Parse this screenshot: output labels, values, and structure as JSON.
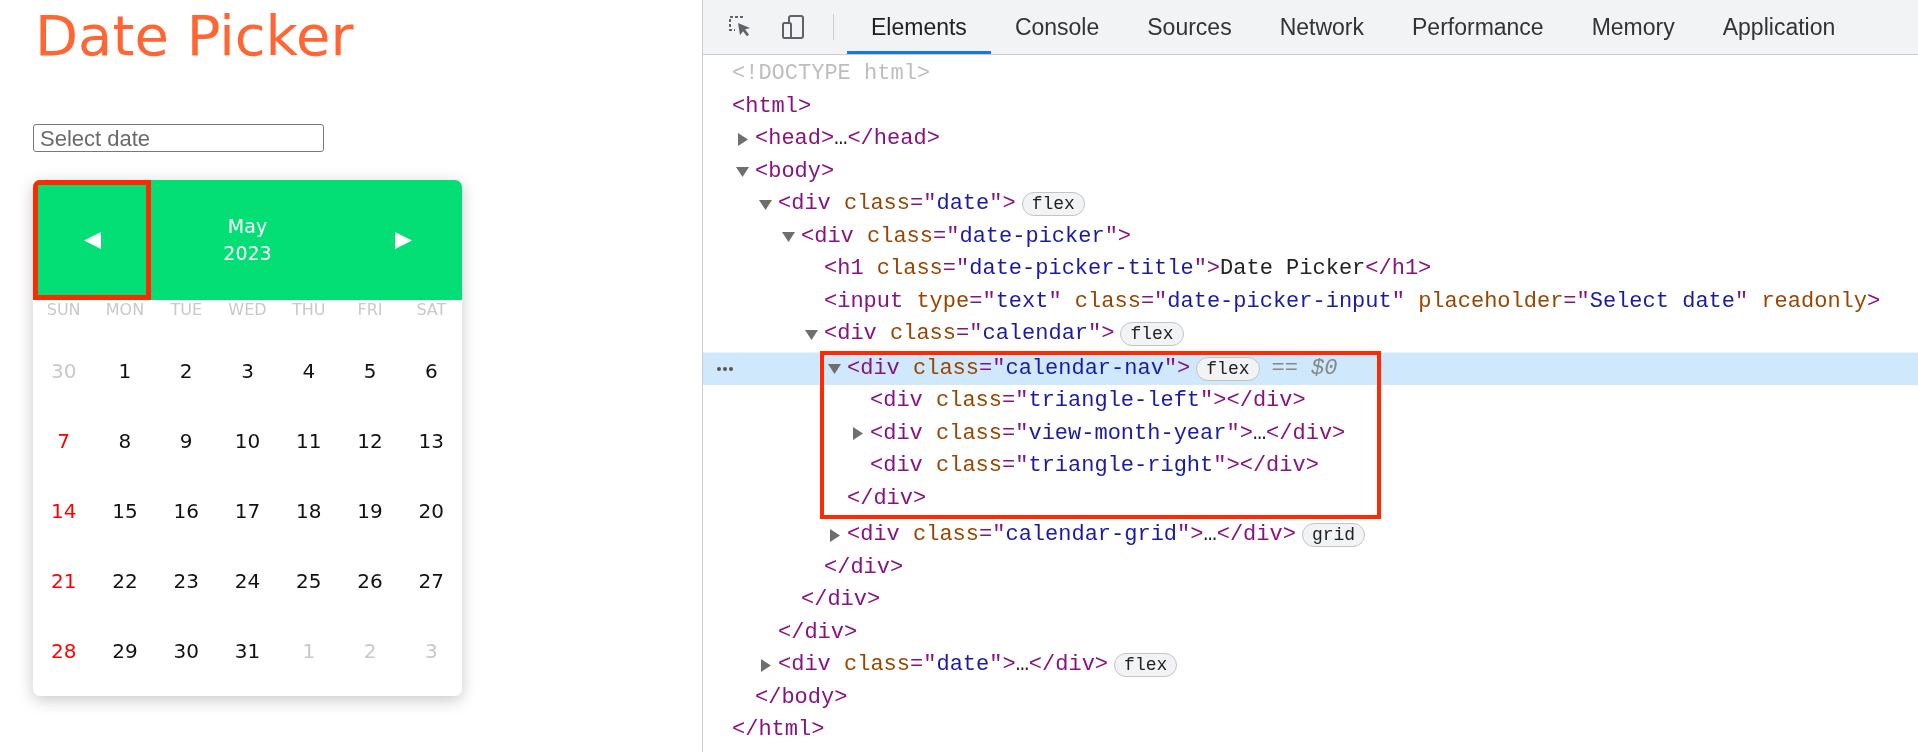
{
  "page": {
    "title": "Date Picker",
    "input": {
      "placeholder": "Select date"
    },
    "calendar": {
      "month": "May",
      "year": "2023",
      "prev_highlighted": true,
      "weekdays": [
        "SUN",
        "MON",
        "TUE",
        "WED",
        "THU",
        "FRI",
        "SAT"
      ],
      "weeks": [
        [
          {
            "day": "30",
            "kind": "other"
          },
          {
            "day": "1",
            "kind": "normal"
          },
          {
            "day": "2",
            "kind": "normal"
          },
          {
            "day": "3",
            "kind": "normal"
          },
          {
            "day": "4",
            "kind": "normal"
          },
          {
            "day": "5",
            "kind": "normal"
          },
          {
            "day": "6",
            "kind": "normal"
          }
        ],
        [
          {
            "day": "7",
            "kind": "sunday"
          },
          {
            "day": "8",
            "kind": "normal"
          },
          {
            "day": "9",
            "kind": "normal"
          },
          {
            "day": "10",
            "kind": "normal"
          },
          {
            "day": "11",
            "kind": "normal"
          },
          {
            "day": "12",
            "kind": "normal"
          },
          {
            "day": "13",
            "kind": "normal"
          }
        ],
        [
          {
            "day": "14",
            "kind": "sunday"
          },
          {
            "day": "15",
            "kind": "normal"
          },
          {
            "day": "16",
            "kind": "normal"
          },
          {
            "day": "17",
            "kind": "normal"
          },
          {
            "day": "18",
            "kind": "normal"
          },
          {
            "day": "19",
            "kind": "normal"
          },
          {
            "day": "20",
            "kind": "normal"
          }
        ],
        [
          {
            "day": "21",
            "kind": "sunday"
          },
          {
            "day": "22",
            "kind": "normal"
          },
          {
            "day": "23",
            "kind": "normal"
          },
          {
            "day": "24",
            "kind": "normal"
          },
          {
            "day": "25",
            "kind": "normal"
          },
          {
            "day": "26",
            "kind": "normal"
          },
          {
            "day": "27",
            "kind": "normal"
          }
        ],
        [
          {
            "day": "28",
            "kind": "sunday"
          },
          {
            "day": "29",
            "kind": "normal"
          },
          {
            "day": "30",
            "kind": "normal"
          },
          {
            "day": "31",
            "kind": "normal"
          },
          {
            "day": "1",
            "kind": "other"
          },
          {
            "day": "2",
            "kind": "other"
          },
          {
            "day": "3",
            "kind": "other"
          }
        ]
      ]
    }
  },
  "devtools": {
    "tabs": [
      {
        "label": "Elements",
        "selected": true
      },
      {
        "label": "Console",
        "selected": false
      },
      {
        "label": "Sources",
        "selected": false
      },
      {
        "label": "Network",
        "selected": false
      },
      {
        "label": "Performance",
        "selected": false
      },
      {
        "label": "Memory",
        "selected": false
      },
      {
        "label": "Application",
        "selected": false
      }
    ],
    "tree": [
      {
        "selected": false,
        "open": [
          {
            "kind": "doc",
            "text": "<!DOCTYPE html>"
          }
        ]
      },
      {
        "selected": false,
        "open": [
          {
            "kind": "tag",
            "text": "<html>"
          }
        ],
        "close": [
          {
            "kind": "tag",
            "text": "</html>"
          }
        ],
        "children": [
          {
            "selected": false,
            "expanded": false,
            "open": [
              {
                "kind": "tag",
                "text": "<head>"
              },
              {
                "kind": "text",
                "text": "…"
              },
              {
                "kind": "tag",
                "text": "</head>"
              }
            ]
          },
          {
            "selected": false,
            "expanded": true,
            "open": [
              {
                "kind": "tag",
                "text": "<body>"
              }
            ],
            "close": [
              {
                "kind": "tag",
                "text": "</body>"
              }
            ],
            "children": [
              {
                "selected": false,
                "expanded": true,
                "open": [
                  {
                    "kind": "tag",
                    "text": "<div "
                  },
                  {
                    "kind": "attr",
                    "text": "class"
                  },
                  {
                    "kind": "tag",
                    "text": "=\""
                  },
                  {
                    "kind": "val",
                    "text": "date"
                  },
                  {
                    "kind": "tag",
                    "text": "\">"
                  }
                ],
                "badge": "flex",
                "close": [
                  {
                    "kind": "tag",
                    "text": "</div>"
                  }
                ],
                "children": [
                  {
                    "selected": false,
                    "expanded": true,
                    "open": [
                      {
                        "kind": "tag",
                        "text": "<div "
                      },
                      {
                        "kind": "attr",
                        "text": "class"
                      },
                      {
                        "kind": "tag",
                        "text": "=\""
                      },
                      {
                        "kind": "val",
                        "text": "date-picker"
                      },
                      {
                        "kind": "tag",
                        "text": "\">"
                      }
                    ],
                    "close": [
                      {
                        "kind": "tag",
                        "text": "</div>"
                      }
                    ],
                    "children": [
                      {
                        "selected": false,
                        "open": [
                          {
                            "kind": "tag",
                            "text": "<h1 "
                          },
                          {
                            "kind": "attr",
                            "text": "class"
                          },
                          {
                            "kind": "tag",
                            "text": "=\""
                          },
                          {
                            "kind": "val",
                            "text": "date-picker-title"
                          },
                          {
                            "kind": "tag",
                            "text": "\">"
                          },
                          {
                            "kind": "text",
                            "text": "Date Picker"
                          },
                          {
                            "kind": "tag",
                            "text": "</h1>"
                          }
                        ]
                      },
                      {
                        "selected": false,
                        "open": [
                          {
                            "kind": "tag",
                            "text": "<input "
                          },
                          {
                            "kind": "attr",
                            "text": "type"
                          },
                          {
                            "kind": "tag",
                            "text": "=\""
                          },
                          {
                            "kind": "val",
                            "text": "text"
                          },
                          {
                            "kind": "tag",
                            "text": "\" "
                          },
                          {
                            "kind": "attr",
                            "text": "class"
                          },
                          {
                            "kind": "tag",
                            "text": "=\""
                          },
                          {
                            "kind": "val",
                            "text": "date-picker-input"
                          },
                          {
                            "kind": "tag",
                            "text": "\" "
                          },
                          {
                            "kind": "attr",
                            "text": "placeholder"
                          },
                          {
                            "kind": "tag",
                            "text": "=\""
                          },
                          {
                            "kind": "val",
                            "text": "Select date"
                          },
                          {
                            "kind": "tag",
                            "text": "\" "
                          },
                          {
                            "kind": "attr",
                            "text": "readonly"
                          },
                          {
                            "kind": "tag",
                            "text": ">"
                          }
                        ]
                      },
                      {
                        "selected": false,
                        "expanded": true,
                        "open": [
                          {
                            "kind": "tag",
                            "text": "<div "
                          },
                          {
                            "kind": "attr",
                            "text": "class"
                          },
                          {
                            "kind": "tag",
                            "text": "=\""
                          },
                          {
                            "kind": "val",
                            "text": "calendar"
                          },
                          {
                            "kind": "tag",
                            "text": "\">"
                          }
                        ],
                        "badge": "flex",
                        "close": [
                          {
                            "kind": "tag",
                            "text": "</div>"
                          }
                        ],
                        "children": [
                          {
                            "selected": true,
                            "highlighted": true,
                            "expanded": true,
                            "open": [
                              {
                                "kind": "tag",
                                "text": "<div "
                              },
                              {
                                "kind": "attr",
                                "text": "class"
                              },
                              {
                                "kind": "tag",
                                "text": "=\""
                              },
                              {
                                "kind": "val",
                                "text": "calendar-nav"
                              },
                              {
                                "kind": "tag",
                                "text": "\">"
                              }
                            ],
                            "badge": "flex",
                            "ref": "== $0",
                            "close": [
                              {
                                "kind": "tag",
                                "text": "</div>"
                              }
                            ],
                            "children": [
                              {
                                "selected": false,
                                "open": [
                                  {
                                    "kind": "tag",
                                    "text": "<div "
                                  },
                                  {
                                    "kind": "attr",
                                    "text": "class"
                                  },
                                  {
                                    "kind": "tag",
                                    "text": "=\""
                                  },
                                  {
                                    "kind": "val",
                                    "text": "triangle-left"
                                  },
                                  {
                                    "kind": "tag",
                                    "text": "\"></div>"
                                  }
                                ]
                              },
                              {
                                "selected": false,
                                "expanded": false,
                                "open": [
                                  {
                                    "kind": "tag",
                                    "text": "<div "
                                  },
                                  {
                                    "kind": "attr",
                                    "text": "class"
                                  },
                                  {
                                    "kind": "tag",
                                    "text": "=\""
                                  },
                                  {
                                    "kind": "val",
                                    "text": "view-month-year"
                                  },
                                  {
                                    "kind": "tag",
                                    "text": "\">"
                                  },
                                  {
                                    "kind": "text",
                                    "text": "…"
                                  },
                                  {
                                    "kind": "tag",
                                    "text": "</div>"
                                  }
                                ]
                              },
                              {
                                "selected": false,
                                "open": [
                                  {
                                    "kind": "tag",
                                    "text": "<div "
                                  },
                                  {
                                    "kind": "attr",
                                    "text": "class"
                                  },
                                  {
                                    "kind": "tag",
                                    "text": "=\""
                                  },
                                  {
                                    "kind": "val",
                                    "text": "triangle-right"
                                  },
                                  {
                                    "kind": "tag",
                                    "text": "\"></div>"
                                  }
                                ]
                              }
                            ]
                          },
                          {
                            "selected": false,
                            "expanded": false,
                            "open": [
                              {
                                "kind": "tag",
                                "text": "<div "
                              },
                              {
                                "kind": "attr",
                                "text": "class"
                              },
                              {
                                "kind": "tag",
                                "text": "=\""
                              },
                              {
                                "kind": "val",
                                "text": "calendar-grid"
                              },
                              {
                                "kind": "tag",
                                "text": "\">"
                              },
                              {
                                "kind": "text",
                                "text": "…"
                              },
                              {
                                "kind": "tag",
                                "text": "</div>"
                              }
                            ],
                            "badge": "grid"
                          }
                        ]
                      }
                    ]
                  }
                ]
              },
              {
                "selected": false,
                "expanded": false,
                "open": [
                  {
                    "kind": "tag",
                    "text": "<div "
                  },
                  {
                    "kind": "attr",
                    "text": "class"
                  },
                  {
                    "kind": "tag",
                    "text": "=\""
                  },
                  {
                    "kind": "val",
                    "text": "date"
                  },
                  {
                    "kind": "tag",
                    "text": "\">"
                  },
                  {
                    "kind": "text",
                    "text": "…"
                  },
                  {
                    "kind": "tag",
                    "text": "</div>"
                  }
                ],
                "badge": "flex"
              }
            ]
          }
        ]
      }
    ]
  }
}
